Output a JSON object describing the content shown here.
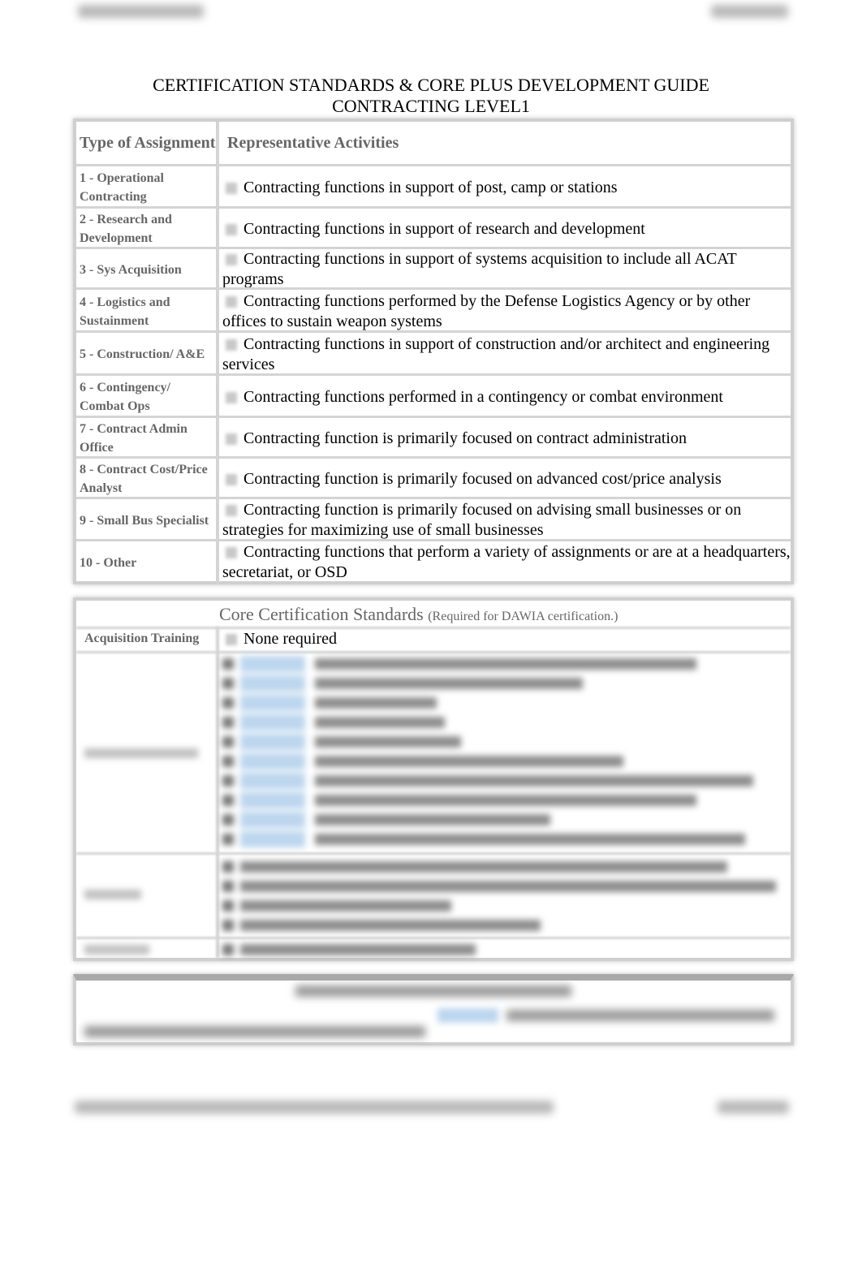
{
  "document": {
    "title_line1": "CERTIFICATION STANDARDS & CORE PLUS DEVELOPMENT GUIDE",
    "title_line2": "CONTRACTING  LEVEL1"
  },
  "assignments_table": {
    "header_type": "Type of Assignment",
    "header_activities": "Representative Activities",
    "rows": [
      {
        "type": "1 - Operational Contracting",
        "activity": "Contracting functions in support of post, camp or stations"
      },
      {
        "type": "2 - Research and Development",
        "activity": "Contracting functions in support of research and development"
      },
      {
        "type": "3 - Sys Acquisition",
        "activity": "Contracting functions in support of systems acquisition to include all ACAT programs"
      },
      {
        "type": "4 - Logistics and Sustainment",
        "activity": "Contracting functions performed by the Defense Logistics Agency or by other offices to sustain weapon systems"
      },
      {
        "type": "5 - Construction/ A&E",
        "activity": "Contracting functions in support of construction and/or architect and engineering services"
      },
      {
        "type": "6 - Contingency/ Combat Ops",
        "activity": "Contracting functions performed in a contingency or combat environment"
      },
      {
        "type": "7 - Contract Admin Office",
        "activity": "Contracting function is primarily focused on contract administration"
      },
      {
        "type": "8 - Contract Cost/Price Analyst",
        "activity": "Contracting function is primarily focused on advanced cost/price analysis"
      },
      {
        "type": "9 - Small Bus Specialist",
        "activity": "Contracting function is primarily focused on advising small businesses or on strategies for maximizing use of small businesses"
      },
      {
        "type": "10 - Other",
        "activity": "Contracting functions that perform a variety of assignments or are at a headquarters, secretariat, or OSD"
      }
    ]
  },
  "core_standards": {
    "heading": "Core Certification Standards",
    "note": "(Required for DAWIA certification.)",
    "acquisition_training_label": "Acquisition Training",
    "acquisition_training_value": "None required"
  },
  "colors": {
    "label_gray": "#666666",
    "border_gray": "#d4d4d4",
    "link_blue": "#bcd6ee"
  }
}
